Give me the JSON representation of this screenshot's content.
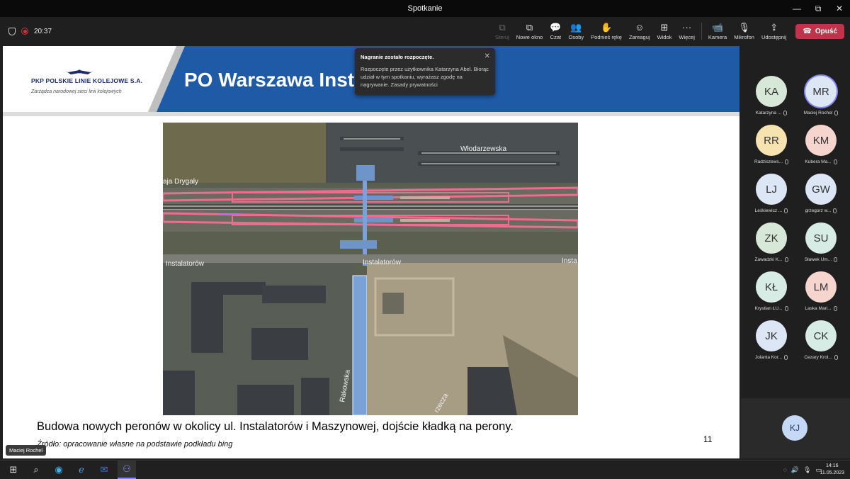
{
  "window": {
    "title": "Spotkanie",
    "controls": [
      "—",
      "▢",
      "⧉",
      "✕"
    ]
  },
  "meeting": {
    "elapsed": "20:37",
    "tools": [
      {
        "label": "Steruj",
        "icon": "⧉",
        "disabled": true,
        "name": "take-control-button"
      },
      {
        "label": "Nowe okno",
        "icon": "⧉",
        "disabled": false,
        "name": "new-window-button"
      },
      {
        "label": "Czat",
        "icon": "💬",
        "disabled": false,
        "name": "chat-button"
      },
      {
        "label": "Osoby",
        "icon": "👥",
        "disabled": false,
        "name": "people-button"
      },
      {
        "label": "Podnieś rękę",
        "icon": "✋",
        "disabled": false,
        "name": "raise-hand-button"
      },
      {
        "label": "Zareaguj",
        "icon": "☺",
        "disabled": false,
        "name": "react-button"
      },
      {
        "label": "Widok",
        "icon": "⊞",
        "disabled": false,
        "name": "view-button"
      },
      {
        "label": "Więcej",
        "icon": "···",
        "disabled": false,
        "name": "more-button"
      }
    ],
    "media": [
      {
        "label": "Kamera",
        "icon": "📹",
        "name": "camera-button"
      },
      {
        "label": "Mikrofon",
        "icon": "🎙",
        "name": "microphone-button"
      },
      {
        "label": "Udostępnij",
        "icon": "⇪",
        "name": "share-button"
      }
    ],
    "leave_label": "Opuść"
  },
  "slide": {
    "logo_name": "PKP POLSKIE LINIE KOLEJOWE S.A.",
    "logo_sub": "Zarządca narodowej sieci linii kolejowych",
    "title": "PO Warszawa Inst",
    "map_labels": {
      "wlodarzewska": "Włodarzewska",
      "drygaly": "aja Drygały",
      "instalatorow_left": "Instalatorów",
      "instalatorow_center": "Instalatorów",
      "instalatorow_right": "Insta",
      "rakowska": "Rakowska",
      "rzecza": "rzecza"
    },
    "caption": "Budowa nowych peronów w okolicy ul. Instalatorów i Maszynowej, dojście kładką na perony.",
    "source": "Źródło: opracowanie własne na podstawie podkładu bing",
    "page_number": "11",
    "presenter": "Maciej Rochel"
  },
  "toast": {
    "title": "Nagranie zostało rozpoczęte.",
    "body": "Rozpoczęte przez użytkownika Katarzyna Abel. Biorąc udział w tym spotkaniu, wyrażasz zgodę na nagrywanie. Zasady prywatności"
  },
  "participants": [
    {
      "initials": "KA",
      "name": "Katarzyna ...",
      "color": "#d8e8d8",
      "speaking": false
    },
    {
      "initials": "MR",
      "name": "Maciej Rochel",
      "color": "#dce6f5",
      "speaking": true
    },
    {
      "initials": "RR",
      "name": "Radziszews...",
      "color": "#f7e3b0",
      "speaking": false
    },
    {
      "initials": "KM",
      "name": "Kubera Ma...",
      "color": "#f6d5cf",
      "speaking": false
    },
    {
      "initials": "LJ",
      "name": "Leśkiewicz ...",
      "color": "#dce6f5",
      "speaking": false
    },
    {
      "initials": "GW",
      "name": "grzegorz w...",
      "color": "#dce6f5",
      "speaking": false
    },
    {
      "initials": "ZK",
      "name": "Zawadzki K...",
      "color": "#d8e8d8",
      "speaking": false
    },
    {
      "initials": "SU",
      "name": "Sławek Um...",
      "color": "#d8ece6",
      "speaking": false
    },
    {
      "initials": "KŁ",
      "name": "Krystian ŁU...",
      "color": "#d8ece6",
      "speaking": false
    },
    {
      "initials": "LM",
      "name": "Laska Mari...",
      "color": "#f6d5cf",
      "speaking": false
    },
    {
      "initials": "JK",
      "name": "Jolanta Kor...",
      "color": "#dce6f5",
      "speaking": false
    },
    {
      "initials": "CK",
      "name": "Cezary Krol...",
      "color": "#d8ece6",
      "speaking": false
    }
  ],
  "self_view": {
    "initials": "KJ"
  },
  "taskbar": {
    "time": "14:16",
    "date": "11.05.2023"
  }
}
